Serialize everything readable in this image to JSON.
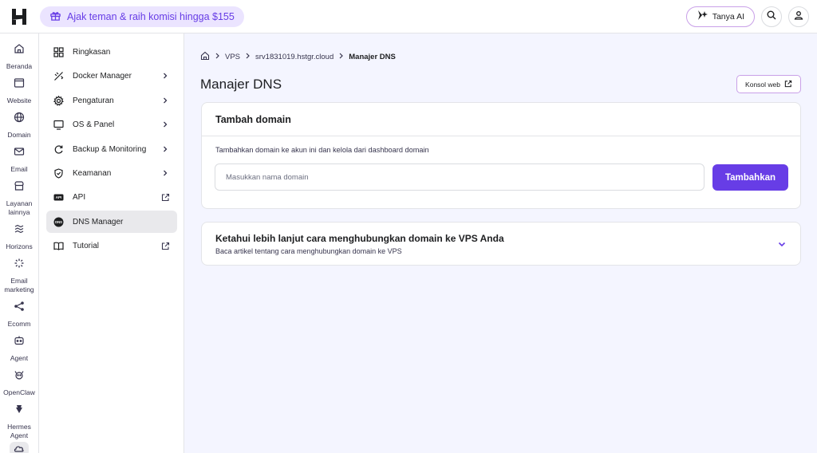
{
  "topbar": {
    "logo_icon": "hostinger-logo-icon",
    "promo_text": "Ajak teman & raih komisi hingga $155",
    "ai_button_label": "Tanya AI",
    "search_icon": "search-icon",
    "account_icon": "user-icon",
    "accent_color": "#673de6"
  },
  "rail": [
    {
      "label": "Beranda",
      "icon": "home-icon"
    },
    {
      "label": "Website",
      "icon": "browser-window-icon"
    },
    {
      "label": "Domain",
      "icon": "globe-icon"
    },
    {
      "label": "Email",
      "icon": "mail-icon"
    },
    {
      "label": "Layanan lainnya",
      "icon": "storefront-icon"
    },
    {
      "label": "Horizons",
      "icon": "horizons-icon"
    },
    {
      "label": "Email marketing",
      "icon": "sparkle-icon"
    },
    {
      "label": "Ecomm",
      "icon": "share-nodes-icon"
    },
    {
      "label": "Agent",
      "icon": "robot-icon"
    },
    {
      "label": "OpenClaw",
      "icon": "claw-icon"
    },
    {
      "label": "Hermes Agent",
      "icon": "hermes-icon"
    }
  ],
  "subnav": [
    {
      "label": "Ringkasan",
      "icon": "grid-icon",
      "trail": ""
    },
    {
      "label": "Docker Manager",
      "icon": "docker-icon",
      "trail": "chevron"
    },
    {
      "label": "Pengaturan",
      "icon": "gear-icon",
      "trail": "chevron"
    },
    {
      "label": "OS & Panel",
      "icon": "monitor-icon",
      "trail": "chevron"
    },
    {
      "label": "Backup & Monitoring",
      "icon": "refresh-icon",
      "trail": "chevron"
    },
    {
      "label": "Keamanan",
      "icon": "shield-icon",
      "trail": "chevron"
    },
    {
      "label": "API",
      "icon": "api-icon",
      "trail": "external"
    },
    {
      "label": "DNS Manager",
      "icon": "dns-icon",
      "trail": ""
    },
    {
      "label": "Tutorial",
      "icon": "book-icon",
      "trail": "external"
    }
  ],
  "breadcrumb": {
    "home_icon": "home-icon",
    "items": [
      "VPS",
      "srv1831019.hstgr.cloud",
      "Manajer DNS"
    ]
  },
  "page": {
    "title": "Manajer DNS",
    "console_button": "Konsol web"
  },
  "add_domain": {
    "heading": "Tambah domain",
    "description": "Tambahkan domain ke akun ini dan kelola dari dashboard domain",
    "placeholder": "Masukkan nama domain",
    "value": "",
    "button": "Tambahkan"
  },
  "learn_more": {
    "title": "Ketahui lebih lanjut cara menghubungkan domain ke VPS Anda",
    "subtitle": "Baca artikel tentang cara menghubungkan domain ke VPS"
  }
}
